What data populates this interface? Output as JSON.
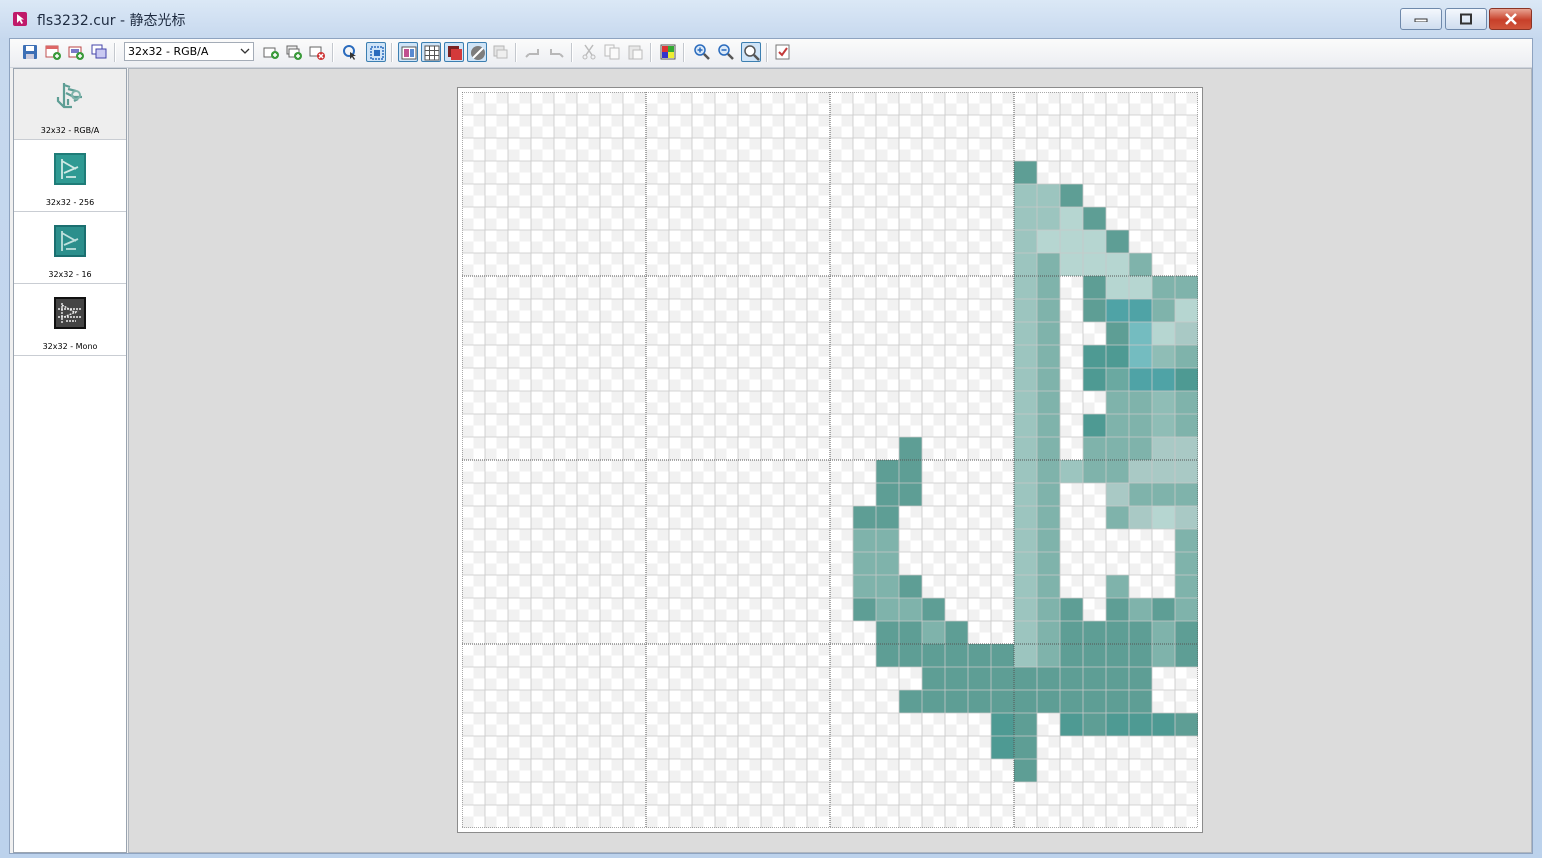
{
  "window": {
    "title": "fls3232.cur - 静态光标"
  },
  "toolbar": {
    "format_select_value": "32x32 - RGB/A",
    "buttons": [
      "save-icon",
      "new-image-icon",
      "new-format-icon",
      "copy-format-icon",
      "add-icon",
      "add-layer-icon",
      "delete-format-icon",
      "hotspot-icon",
      "select-icon",
      "view-mode-icon",
      "grid-icon",
      "color-icon",
      "transparency-icon",
      "print-icon",
      "undo-icon",
      "redo-icon",
      "cut-icon",
      "copy-icon",
      "paste-icon",
      "palette-icon",
      "zoom-in-icon",
      "zoom-out-icon",
      "zoom-tool-icon",
      "check-icon"
    ]
  },
  "formats": [
    {
      "label": "32x32 - RGB/A",
      "selected": true
    },
    {
      "label": "32x32 - 256",
      "selected": false
    },
    {
      "label": "32x32 - 16",
      "selected": false
    },
    {
      "label": "32x32 - Mono",
      "selected": false
    }
  ],
  "editor": {
    "grid_cells": 32,
    "palette": {
      "a": "#5e9e95",
      "b": "#7fb3ab",
      "c": "#9cc5bf",
      "d": "#b6d6d1",
      "e": "#4e9a93",
      "f": "#6aa9a1",
      "g": "#8fbdb6",
      "h": "#4fa3a6",
      "i": "#74bcc0",
      "k": "#a9c9c5",
      "m": "#589c92"
    },
    "pixels": [
      "................................",
      "................................",
      "..................................",
      "........................a.......",
      "........................cca.....",
      "........................ccda....",
      "........................cddda...",
      "........................cbdddb..",
      "........................cb.addbba",
      "........................cb.ahhbdg",
      "........................cb..aidkd",
      "........................cb.eeigbk",
      "........................cb.efhhee",
      "........................cb..bbgbg",
      "........................cb.ebbgbg",
      "...................a....cb.bbbkkd",
      "..................aa....cbcbbkkkb",
      "..................aa....cb..kbbbk",
      ".................aa.....cb..bkdkb",
      ".................bb.....cb.....bk",
      ".................bb.....cb.....bk",
      ".................bba....cb..b..ba",
      ".................abba...cba.abab.",
      "..................aaba..cbaaaaba.",
      "..................aaaaaacbaaaaba.",
      "....................aaaaaaaaaa...",
      "...................aaaaaaaaaaa...",
      ".......................ea.eaeeeaa",
      ".......................ea........",
      "........................a........",
      "................................",
      "................................"
    ]
  }
}
